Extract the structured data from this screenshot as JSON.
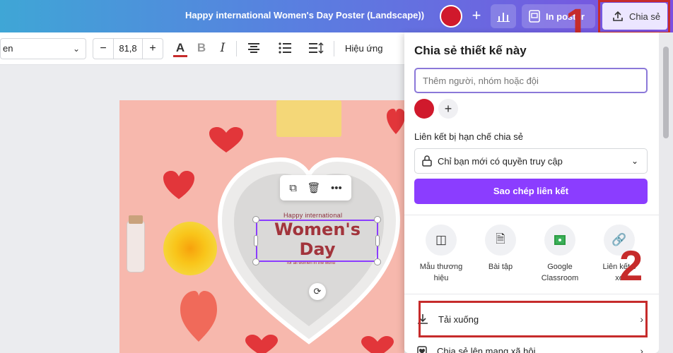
{
  "header": {
    "doc_title": "Happy international Women's  Day Poster (Landscape))",
    "print_label": "In poster",
    "share_label": "Chia sẻ",
    "gradient_start": "#3fa6d6",
    "gradient_end": "#7c4fe0"
  },
  "toolbar": {
    "font_name": "en",
    "font_size": "81,8",
    "effects_label": "Hiệu ứng",
    "text_color": "#c62b2b"
  },
  "canvas": {
    "background": "#f7b8ad",
    "title_small": "Happy international",
    "title_big_line1": "Women's",
    "title_big_line2": "Day",
    "title_tiny": "for all women in the world"
  },
  "share_panel": {
    "title": "Chia sẻ thiết kế này",
    "input_placeholder": "Thêm người, nhóm hoặc đội",
    "link_section_label": "Liên kết bị hạn chế chia sẻ",
    "access_option": "Chỉ bạn mới có quyền truy cập",
    "copy_link_button": "Sao chép liên kết",
    "options": [
      {
        "label_line1": "Mẫu thương",
        "label_line2": "hiệu",
        "icon": "template-icon"
      },
      {
        "label_line1": "Bài tập",
        "label_line2": "",
        "icon": "document-icon"
      },
      {
        "label_line1": "Google",
        "label_line2": "Classroom",
        "icon": "classroom-icon"
      },
      {
        "label_line1": "Liên kết c",
        "label_line2": "xe",
        "icon": "link-icon"
      }
    ],
    "download_label": "Tải xuống",
    "social_label": "Chia sẻ lên mạng xã hội",
    "accent": "#8b3dff"
  },
  "annotations": {
    "step1": "1",
    "step2": "2",
    "highlight_color": "#c62b2b"
  }
}
